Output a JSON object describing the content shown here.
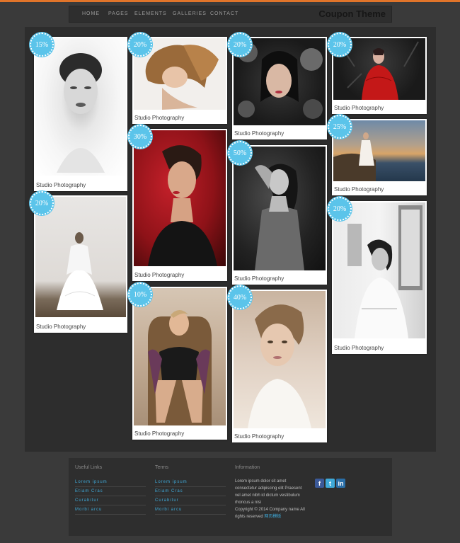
{
  "nav": {
    "items": [
      "HOME",
      "PAGES",
      "ELEMENTS",
      "GALLERIES",
      "CONTACT"
    ],
    "brand": "Coupon Theme"
  },
  "cards": [
    {
      "badge": "15%",
      "caption": "Studio Photography"
    },
    {
      "badge": "20%",
      "caption": "Studio Photography"
    },
    {
      "badge": "20%",
      "caption": "Studio Photography"
    },
    {
      "badge": "30%",
      "caption": "Studio Photography"
    },
    {
      "badge": "10%",
      "caption": "Studio Photography"
    },
    {
      "badge": "20%",
      "caption": "Studio Photography"
    },
    {
      "badge": "50%",
      "caption": "Studio Photography"
    },
    {
      "badge": "40%",
      "caption": "Studio Photography"
    },
    {
      "badge": "20%",
      "caption": "Studio Photography"
    },
    {
      "badge": "25%",
      "caption": "Studio Photography"
    },
    {
      "badge": "20%",
      "caption": "Studio Photography"
    }
  ],
  "footer": {
    "col1": {
      "title": "Useful Links",
      "links": [
        "Lorem ipsum",
        "Etiam Cras",
        "Curabitur",
        "Morbi arcu"
      ]
    },
    "col2": {
      "title": "Terms",
      "links": [
        "Lorem ipsum",
        "Etiam Cras",
        "Curabitur",
        "Morbi arcu"
      ]
    },
    "col3": {
      "title": "Information",
      "text": "Lorem ipsum dolor sit amet consectetur adipiscing elit Praesent vel amet nibh id dictum vestibulum rhoncus a nisi",
      "copyright": "Copyright © 2014 Company name All rights reserved",
      "credit": "网页模板"
    },
    "social": [
      "facebook-icon",
      "twitter-icon",
      "linkedin-icon"
    ]
  },
  "colors": {
    "accent": "#5bc4ea",
    "background": "#3a3a3a",
    "stripe": "#e0742a"
  }
}
